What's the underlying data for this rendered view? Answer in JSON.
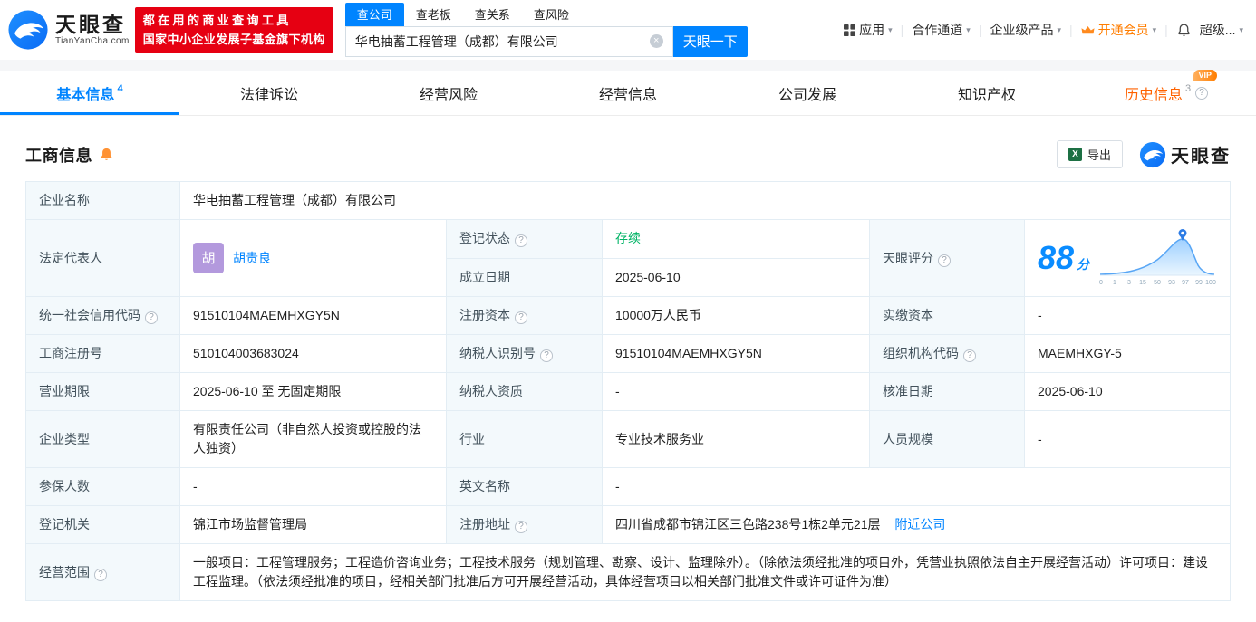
{
  "colors": {
    "brand_blue": "#0084ff",
    "badge_red": "#e60012",
    "vip_orange": "#ff7d00",
    "status_green": "#00b365",
    "history_orange": "#ff6200"
  },
  "icons": {
    "help": "?",
    "caret": "▾",
    "clear": "×",
    "sep": "|",
    "excel_x": "X"
  },
  "header": {
    "logo_cn": "天眼查",
    "logo_en": "TianYanCha.com",
    "badge_line1": "都在用的商业查询工具",
    "badge_line2": "国家中小企业发展子基金旗下机构",
    "search_tabs": [
      {
        "label": "查公司"
      },
      {
        "label": "查老板"
      },
      {
        "label": "查关系"
      },
      {
        "label": "查风险"
      }
    ],
    "search_value": "华电抽蓄工程管理（成都）有限公司",
    "search_button": "天眼一下",
    "nav": {
      "apps": "应用",
      "partner": "合作通道",
      "enterprise": "企业级产品",
      "vip": "开通会员",
      "super": "超级..."
    }
  },
  "tabs": [
    {
      "label": "基本信息",
      "count": "4"
    },
    {
      "label": "法律诉讼"
    },
    {
      "label": "经营风险"
    },
    {
      "label": "经营信息"
    },
    {
      "label": "公司发展"
    },
    {
      "label": "知识产权"
    },
    {
      "label": "历史信息",
      "count": "3",
      "vip": "VIP"
    }
  ],
  "section": {
    "title": "工商信息",
    "export": "导出",
    "brand_cn": "天眼查"
  },
  "info": {
    "company_name_label": "企业名称",
    "company_name": "华电抽蓄工程管理（成都）有限公司",
    "legal_rep_label": "法定代表人",
    "legal_rep_avatar_char": "胡",
    "legal_rep_name": "胡贵良",
    "reg_status_label": "登记状态",
    "reg_status_value": "存续",
    "establish_label": "成立日期",
    "establish_value": "2025-06-10",
    "score_label": "天眼评分",
    "score_value": "88",
    "score_unit": "分",
    "score_axis": [
      "0",
      "1",
      "3",
      "15",
      "50",
      "93",
      "97",
      "99",
      "100"
    ],
    "uscc_label": "统一社会信用代码",
    "uscc_value": "91510104MAEMHXGY5N",
    "reg_capital_label": "注册资本",
    "reg_capital_value": "10000万人民币",
    "paid_capital_label": "实缴资本",
    "paid_capital_value": "-",
    "reg_no_label": "工商注册号",
    "reg_no_value": "510104003683024",
    "taxpayer_id_label": "纳税人识别号",
    "taxpayer_id_value": "91510104MAEMHXGY5N",
    "org_code_label": "组织机构代码",
    "org_code_value": "MAEMHXGY-5",
    "term_label": "营业期限",
    "term_value": "2025-06-10 至 无固定期限",
    "taxpayer_quality_label": "纳税人资质",
    "taxpayer_quality_value": "-",
    "approval_date_label": "核准日期",
    "approval_date_value": "2025-06-10",
    "company_type_label": "企业类型",
    "company_type_value": "有限责任公司（非自然人投资或控股的法人独资）",
    "industry_label": "行业",
    "industry_value": "专业技术服务业",
    "staff_size_label": "人员规模",
    "staff_size_value": "-",
    "insured_label": "参保人数",
    "insured_value": "-",
    "english_name_label": "英文名称",
    "english_name_value": "-",
    "reg_authority_label": "登记机关",
    "reg_authority_value": "锦江市场监督管理局",
    "address_label": "注册地址",
    "address_value": "四川省成都市锦江区三色路238号1栋2单元21层",
    "address_link": "附近公司",
    "scope_label": "经营范围",
    "scope_value": "一般项目：工程管理服务；工程造价咨询业务；工程技术服务（规划管理、勘察、设计、监理除外）。（除依法须经批准的项目外，凭营业执照依法自主开展经营活动）许可项目：建设工程监理。（依法须经批准的项目，经相关部门批准后方可开展经营活动，具体经营项目以相关部门批准文件或许可证件为准）"
  }
}
